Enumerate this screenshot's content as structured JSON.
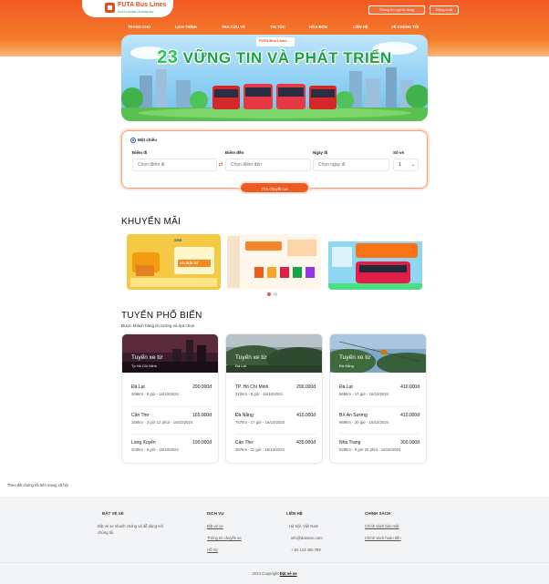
{
  "brand": {
    "name": "FUTA Bus Lines",
    "slogan": "CHẤT LƯỢNG LÀ DANH DỰ"
  },
  "header": {
    "user_info_label": "Thông tin người dùng",
    "logout_label": "Đăng xuất",
    "nav": [
      "TRANG CHỦ",
      "LỊCH TRÌNH",
      "TRA CỨU VÉ",
      "TIN TỨC",
      "HÓA ĐƠN",
      "LIÊN HỆ",
      "VỀ CHÚNG TÔI"
    ]
  },
  "hero": {
    "number": "23",
    "title": "VỮNG TIN VÀ PHÁT TRIỂN",
    "logo": "FUTA Bus Lines"
  },
  "search": {
    "trip_type": "Một chiều",
    "from_label": "Điểm đi",
    "from_placeholder": "Chọn điểm đi",
    "to_label": "Điểm đến",
    "to_placeholder": "Chọn điểm đến",
    "date_label": "Ngày đi",
    "date_placeholder": "Chọn ngày đi",
    "tickets_label": "Số vé",
    "tickets_value": "1",
    "submit_label": "Tìm chuyến xe"
  },
  "promotions": {
    "title": "KHUYẾN MÃI",
    "items": [
      {
        "name": "promo-shb",
        "texts": [
          "SHB",
          "ƯU ĐÃI X3"
        ]
      },
      {
        "name": "promo-futa",
        "texts": []
      },
      {
        "name": "promo-bus",
        "texts": []
      }
    ],
    "active_page": 1,
    "page_count": 2
  },
  "popular": {
    "title": "TUYẾN PHỔ BIẾN",
    "subtitle": "Được khách hàng tin tưởng và lựa chọn",
    "cards": [
      {
        "heading": "Tuyến xe từ",
        "origin": "Tp Hồ Chí Minh",
        "routes": [
          {
            "dest": "Đà Lạt",
            "price": "290.000đ",
            "info": "305km - 8 giờ - 16/10/2024"
          },
          {
            "dest": "Cần Thơ",
            "price": "165.000đ",
            "info": "166km - 3 giờ 12 phút - 16/10/2024"
          },
          {
            "dest": "Long Xuyên",
            "price": "190.000đ",
            "info": "203km - 5 giờ - 16/10/2024"
          }
        ]
      },
      {
        "heading": "Tuyến xe từ",
        "origin": "Đà Lạt",
        "routes": [
          {
            "dest": "TP. Hồ Chí Minh",
            "price": "290.000đ",
            "info": "310km - 8 giờ - 16/10/2024"
          },
          {
            "dest": "Đà Nẵng",
            "price": "410.000đ",
            "info": "757km - 17 giờ - 16/10/2024"
          },
          {
            "dest": "Cần Thơ",
            "price": "435.000đ",
            "info": "457km - 11 giờ - 16/10/2024"
          }
        ]
      },
      {
        "heading": "Tuyến xe từ",
        "origin": "Đà Nẵng",
        "routes": [
          {
            "dest": "Đà Lạt",
            "price": "410.000đ",
            "info": "666km - 17 giờ - 16/10/2024"
          },
          {
            "dest": "BX An Sương",
            "price": "410.000đ",
            "info": "969km - 20 giờ - 16/10/2024"
          },
          {
            "dest": "Nha Trang",
            "price": "300.000đ",
            "info": "528km - 9 giờ 25 phút - 16/10/2024"
          }
        ]
      }
    ]
  },
  "footer": {
    "follow": "Theo dõi chúng tôi trên mạng xã hội",
    "col1": {
      "title": "ĐẶT VÉ XE",
      "text1": "Đặt vé xe nhanh chóng và dễ dàng với",
      "text2": "chúng tôi."
    },
    "col2": {
      "title": "DỊCH VỤ",
      "links": [
        "Đặt vé xe",
        "Thông tin chuyến xe",
        "Hỗ trợ"
      ]
    },
    "col3": {
      "title": "LIÊN HỆ",
      "lines": [
        "Hà Nội, Việt Nam",
        "info@datvexe.com",
        "+ 84 123 456 789"
      ]
    },
    "col4": {
      "title": "CHÍNH SÁCH",
      "links": [
        "Chính sách bảo mật",
        "Chính sách hoàn tiền"
      ]
    },
    "copyright_prefix": "2023 Copyright",
    "copyright_brand": "Đặt vé xe"
  },
  "colors": {
    "primary": "#ef5a20",
    "accent_green": "#16a34a"
  }
}
